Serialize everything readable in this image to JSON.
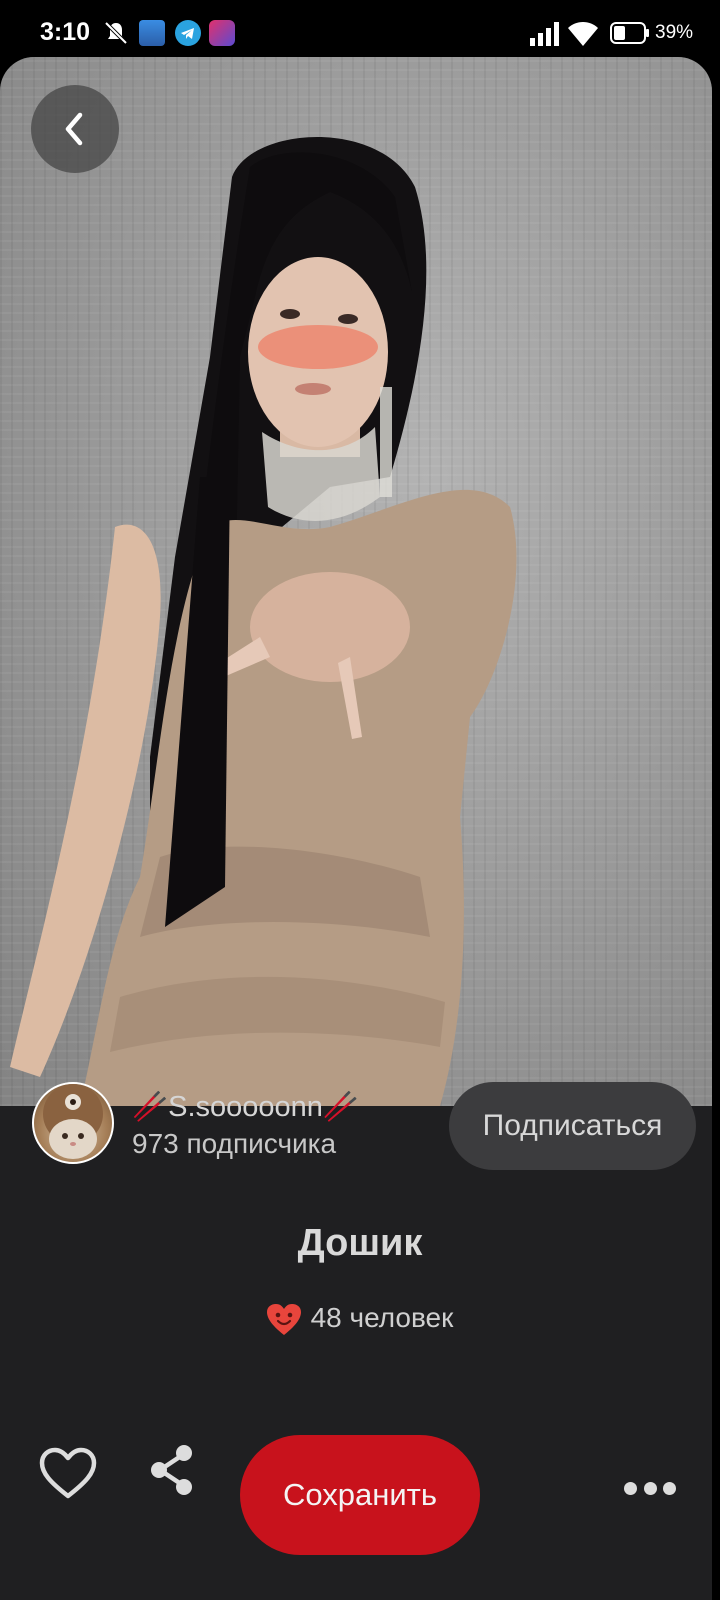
{
  "status_bar": {
    "time": "3:10",
    "battery_percent": "39%",
    "icons": [
      "mute-icon",
      "app-icon",
      "telegram-icon",
      "app-icon",
      "signal-icon",
      "wifi-icon",
      "battery-icon"
    ]
  },
  "pin": {
    "author": {
      "name": "🥢S.sooooonn🥢",
      "followers": "973 подписчика",
      "follow_label": "Подписаться"
    },
    "title": "Дошик",
    "reactions": "48 человек"
  },
  "actions": {
    "save_label": "Сохранить"
  },
  "colors": {
    "accent": "#c8121c",
    "background": "#1f1f21",
    "reaction": "#e8453c"
  }
}
